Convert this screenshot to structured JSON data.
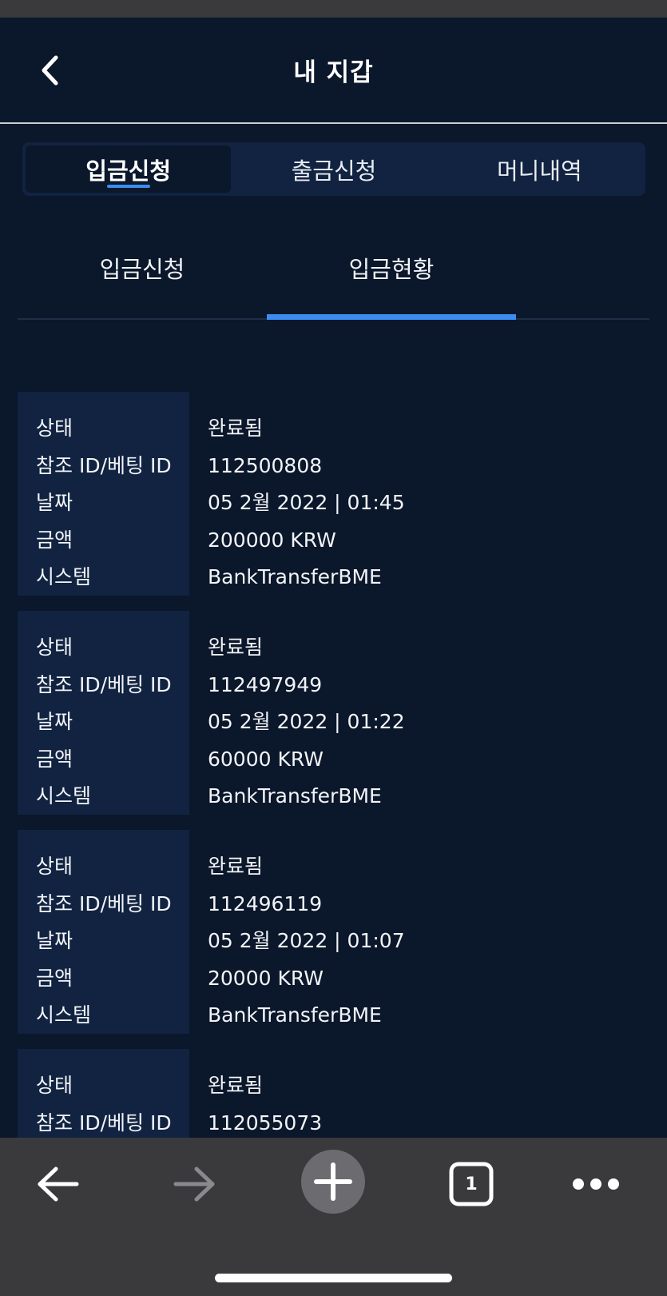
{
  "header": {
    "title": "내 지갑",
    "back_icon": "chevron-left-icon"
  },
  "main_tabs": [
    {
      "label": "입금신청",
      "active": true
    },
    {
      "label": "출금신청",
      "active": false
    },
    {
      "label": "머니내역",
      "active": false
    }
  ],
  "sub_tabs": [
    {
      "label": "입금신청",
      "active": false
    },
    {
      "label": "입금현황",
      "active": true
    }
  ],
  "field_labels": {
    "status": "상태",
    "reference": "참조 ID/베팅 ID",
    "date": "날짜",
    "amount": "금액",
    "system": "시스템"
  },
  "records": [
    {
      "status": "완료됨",
      "reference": "112500808",
      "date": "05 2월 2022 | 01:45",
      "amount": "200000 KRW",
      "system": "BankTransferBME"
    },
    {
      "status": "완료됨",
      "reference": "112497949",
      "date": "05 2월 2022 | 01:22",
      "amount": "60000 KRW",
      "system": "BankTransferBME"
    },
    {
      "status": "완료됨",
      "reference": "112496119",
      "date": "05 2월 2022 | 01:07",
      "amount": "20000 KRW",
      "system": "BankTransferBME"
    },
    {
      "status": "완료됨",
      "reference": "112055073",
      "date": "",
      "amount": "",
      "system": ""
    }
  ],
  "browser_bar": {
    "tab_count": "1",
    "icons": [
      "arrow-left-icon",
      "arrow-right-icon",
      "plus-icon",
      "tabs-icon",
      "more-icon"
    ]
  },
  "colors": {
    "background": "#0b172a",
    "panel": "#112341",
    "accent": "#3b8cf0",
    "browser_bar": "#3a3a3c"
  }
}
